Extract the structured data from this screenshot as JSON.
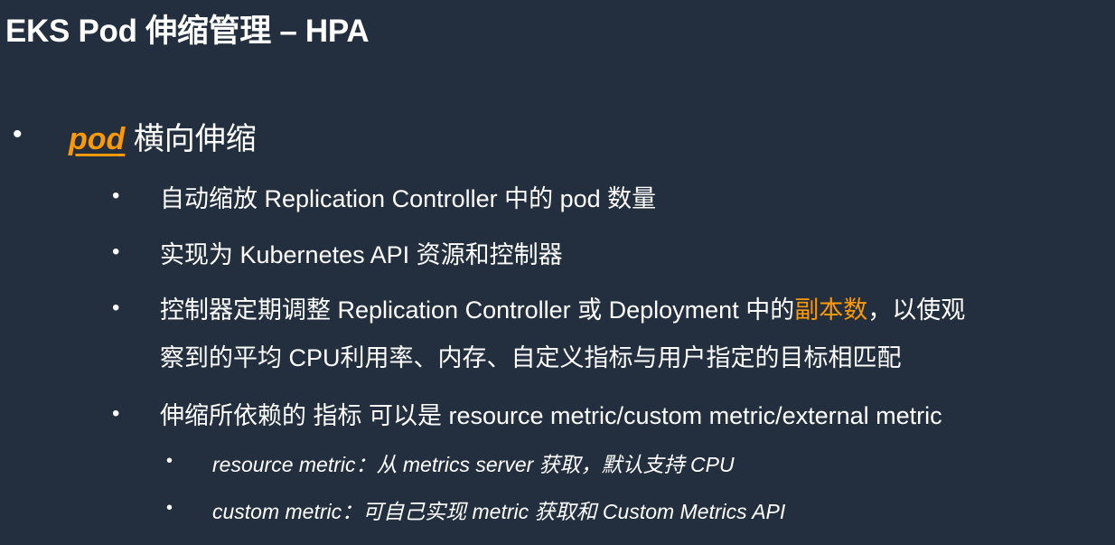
{
  "title": "EKS Pod 伸缩管理 – HPA",
  "colors": {
    "background": "#232F3E",
    "text": "#FFFFFF",
    "accent": "#FF9900"
  },
  "bullets": {
    "marker": "•",
    "level1": {
      "highlight": "pod",
      "text": " 横向伸缩"
    },
    "level2": [
      {
        "text": "自动缩放 Replication Controller 中的 pod 数量"
      },
      {
        "text": "实现为 Kubernetes API 资源和控制器"
      },
      {
        "text_before": "控制器定期调整 Replication Controller 或 Deployment 中的",
        "highlight": "副本数",
        "text_after": "，以使观",
        "line2": "察到的平均 CPU利用率、内存、自定义指标与用户指定的目标相匹配"
      },
      {
        "text": "伸缩所依赖的 指标 可以是 resource metric/custom metric/external metric"
      }
    ],
    "level3": [
      {
        "text": "resource metric：从 metrics server 获取，默认支持 CPU"
      },
      {
        "text": "custom metric：可自己实现 metric 获取和 Custom Metrics API"
      }
    ]
  }
}
